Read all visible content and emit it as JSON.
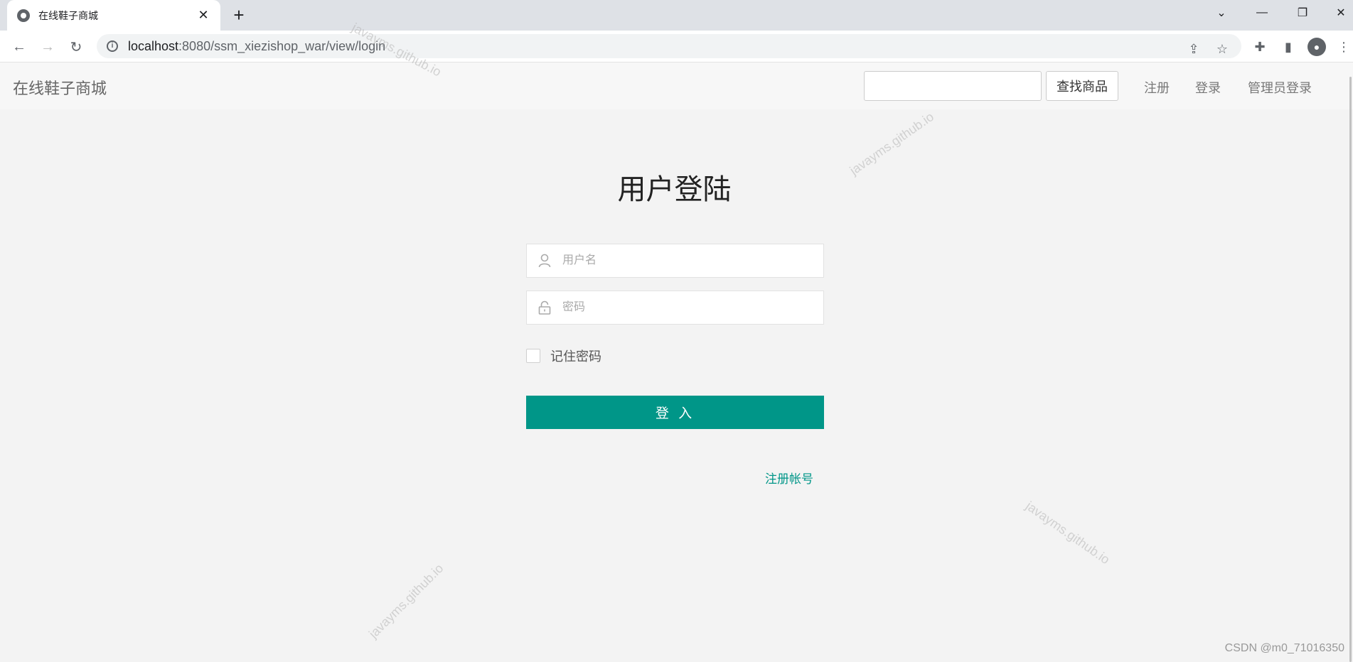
{
  "browser": {
    "tab_title": "在线鞋子商城",
    "new_tab": "+",
    "url_host": "localhost",
    "url_rest": ":8080/ssm_xiezishop_war/view/login"
  },
  "header": {
    "brand": "在线鞋子商城",
    "search_placeholder": "",
    "search_button": "查找商品",
    "nav": {
      "register": "注册",
      "login": "登录",
      "admin_login": "管理员登录"
    }
  },
  "login": {
    "title": "用户登陆",
    "username_placeholder": "用户名",
    "password_placeholder": "密码",
    "remember_label": "记住密码",
    "submit_label": "登 入",
    "register_link": "注册帐号"
  },
  "colors": {
    "accent": "#009688",
    "page_bg": "#f3f3f3",
    "header_bg": "#f7f7f7"
  },
  "watermark_text": "javayms.github.io",
  "credit": "CSDN @m0_71016350"
}
